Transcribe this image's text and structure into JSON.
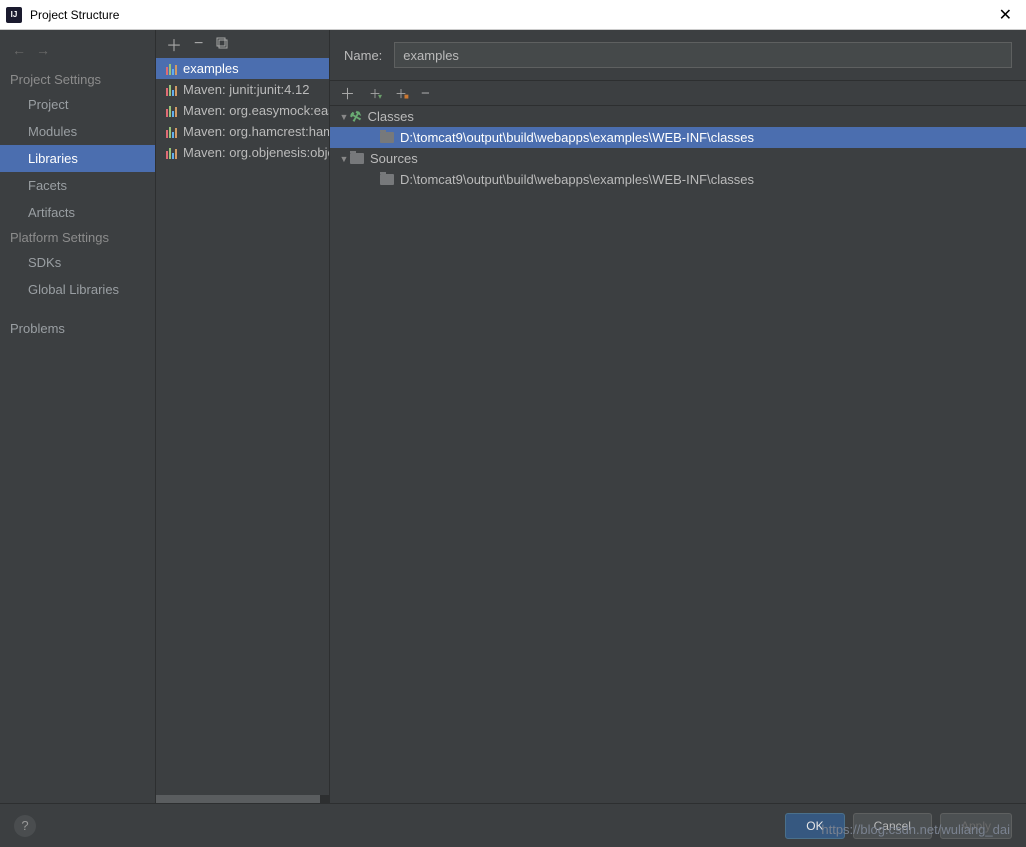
{
  "window": {
    "title": "Project Structure"
  },
  "sidebar": {
    "section_project": "Project Settings",
    "items_project": [
      "Project",
      "Modules",
      "Libraries",
      "Facets",
      "Artifacts"
    ],
    "selected_project": "Libraries",
    "section_platform": "Platform Settings",
    "items_platform": [
      "SDKs",
      "Global Libraries"
    ],
    "problems": "Problems"
  },
  "libraries": {
    "items": [
      {
        "label": "examples"
      },
      {
        "label": "Maven: junit:junit:4.12"
      },
      {
        "label": "Maven: org.easymock:easymock"
      },
      {
        "label": "Maven: org.hamcrest:hamcrest"
      },
      {
        "label": "Maven: org.objenesis:objenesis"
      }
    ],
    "selected": 0
  },
  "detail": {
    "name_label": "Name:",
    "name_value": "examples",
    "tree": [
      {
        "level": 1,
        "kind": "classes",
        "expanded": true,
        "label": "Classes"
      },
      {
        "level": 2,
        "kind": "path",
        "selected": true,
        "label": "D:\\tomcat9\\output\\build\\webapps\\examples\\WEB-INF\\classes"
      },
      {
        "level": 1,
        "kind": "sources",
        "expanded": true,
        "label": "Sources"
      },
      {
        "level": 2,
        "kind": "path",
        "label": "D:\\tomcat9\\output\\build\\webapps\\examples\\WEB-INF\\classes"
      }
    ]
  },
  "footer": {
    "ok": "OK",
    "cancel": "Cancel",
    "apply": "Apply"
  },
  "watermark": "https://blog.csdn.net/wuliang_dai"
}
